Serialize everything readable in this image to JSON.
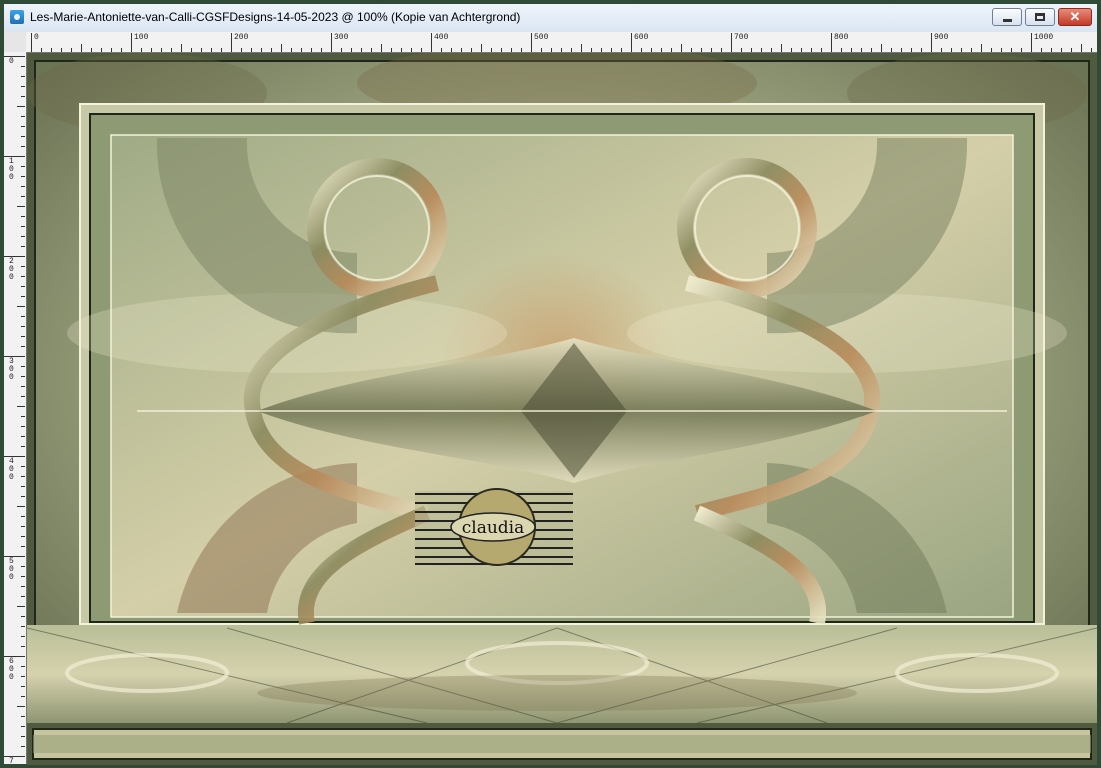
{
  "window": {
    "title": "Les-Marie-Antoniette-van-Calli-CGSFDesigns-14-05-2023 @ 100% (Kopie van Achtergrond)",
    "icon": "paintshop-pro-image-icon",
    "controls": {
      "minimize_icon": "minimize-icon",
      "maximize_icon": "restore-icon",
      "close_icon": "close-icon",
      "close_glyph": "✕"
    }
  },
  "ruler": {
    "top_labels": [
      "0",
      "100",
      "200",
      "300",
      "400",
      "500",
      "600",
      "700",
      "800",
      "900",
      "1000"
    ],
    "left_labels": [
      "0",
      "1 0 0",
      "2 0 0",
      "3 0 0",
      "4 0 0",
      "5 0 0",
      "6 0 0",
      "7"
    ]
  },
  "artwork": {
    "watermark_text": "claudia"
  },
  "colors": {
    "frame": "#2f4a36",
    "title_bg": "#dbe6f3",
    "close_red": "#c43a28",
    "art_sage": "#a8b38a",
    "art_olive": "#6f7a58",
    "art_cream": "#e6e0bd"
  }
}
